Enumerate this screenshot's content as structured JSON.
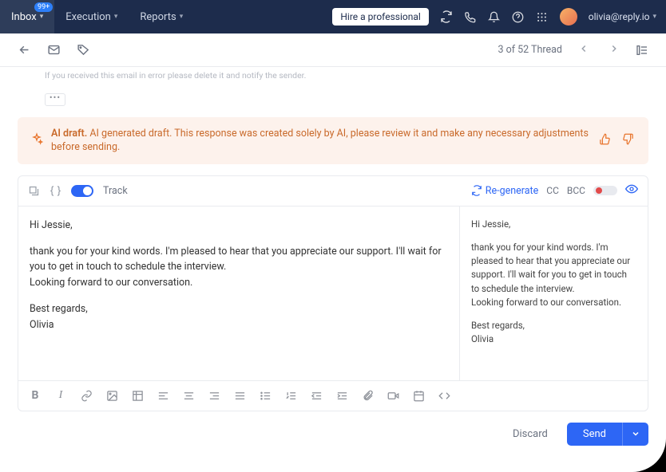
{
  "topnav": {
    "inbox_label": "Inbox",
    "inbox_badge": "99+",
    "execution_label": "Execution",
    "reports_label": "Reports",
    "hire_label": "Hire a professional",
    "user_email": "olivia@reply.io"
  },
  "subbar": {
    "position": "3  of  52 Thread"
  },
  "quoted": {
    "line1": "If you received this email in error please delete it and notify the sender."
  },
  "ai_banner": {
    "title": "AI draft.",
    "body": "AI generated draft. This response was created solely by AI, please review it and make any necessary adjustments before sending."
  },
  "composer": {
    "track_label": "Track",
    "regenerate_label": "Re-generate",
    "cc_label": "CC",
    "bcc_label": "BCC",
    "greeting": "Hi Jessie,",
    "body1": "thank you for your kind words. I'm pleased to hear that you appreciate our support. I'll wait for you to get in touch to schedule the interview.",
    "body2": "Looking forward to our conversation.",
    "signoff": "Best regards,",
    "signature": "Olivia"
  },
  "preview": {
    "greeting": "Hi Jessie,",
    "body1": "thank you for your kind words. I'm pleased to hear that you appreciate our support. I'll wait for you to get in touch to schedule the interview.",
    "body2": "Looking forward to our conversation.",
    "signoff": "Best regards,",
    "signature": "Olivia"
  },
  "footer": {
    "discard_label": "Discard",
    "send_label": "Send"
  }
}
